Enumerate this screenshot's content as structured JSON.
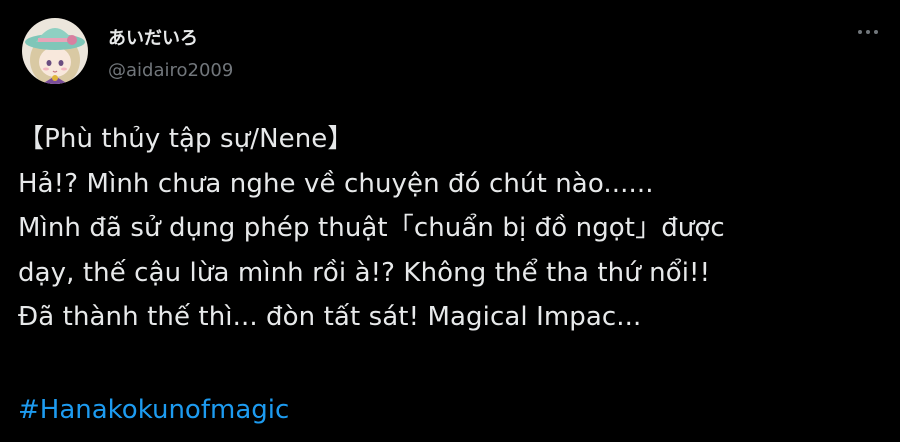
{
  "user": {
    "display_name": "あいだいろ",
    "handle": "@aidairo2009",
    "avatar_icon": "avatar-icon"
  },
  "menu": {
    "more_icon": "more-dots-icon"
  },
  "tweet": {
    "lines": [
      "【Phù thủy tập sự/Nene】",
      "Hả!? Mình chưa nghe về chuyện đó chút nào......",
      "Mình đã sử dụng phép thuật「chuẩn bị đồ ngọt」được",
      "dạy, thế cậu lừa mình rồi à!? Không thể tha thứ nổi!!",
      "Đã thành thế thì... đòn tất sát! Magical Impac..."
    ],
    "hashtag": "#Hanakokunofmagic"
  },
  "colors": {
    "background": "#000000",
    "text": "#e7e9ea",
    "secondary": "#71767b",
    "link": "#1d9bf0"
  }
}
